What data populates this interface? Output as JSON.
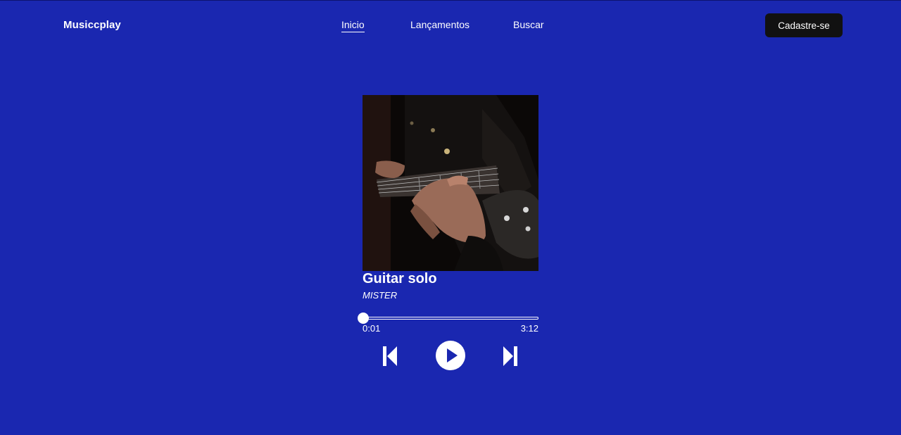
{
  "header": {
    "logo": "Musiccplay",
    "nav": [
      {
        "label": "Inicio",
        "active": true
      },
      {
        "label": "Lançamentos",
        "active": false
      },
      {
        "label": "Buscar",
        "active": false
      }
    ],
    "signup_label": "Cadastre-se"
  },
  "player": {
    "title": "Guitar solo",
    "artist": "MISTER",
    "current_time": "0:01",
    "duration": "3:12",
    "progress": 0.005,
    "icons": {
      "prev": "skip-previous-icon",
      "play": "play-icon",
      "next": "skip-next-icon"
    }
  },
  "colors": {
    "background": "#1a27b0",
    "button": "#111111",
    "text": "#ffffff"
  }
}
